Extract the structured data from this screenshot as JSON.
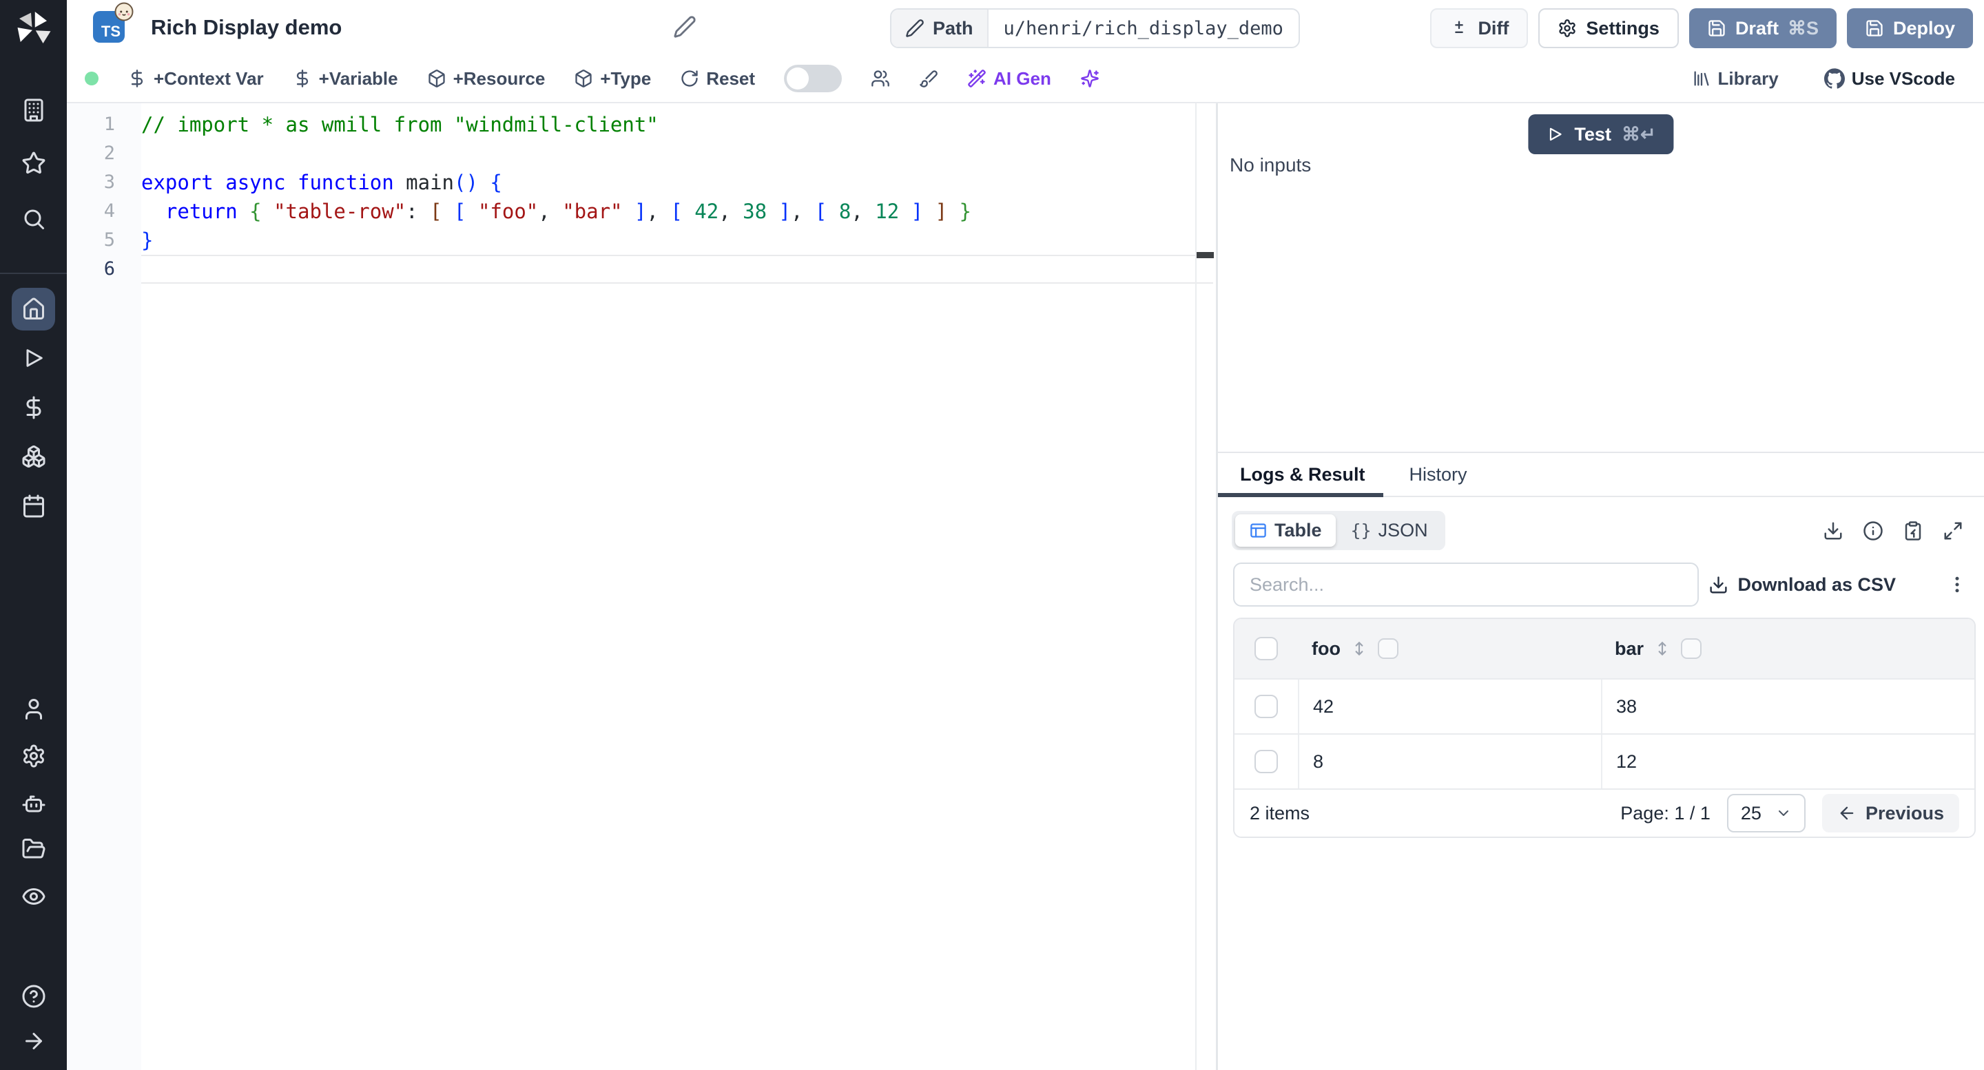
{
  "colors": {
    "slate-btn": "#6b82a6",
    "test-navy": "#3a4a64",
    "ai-purple": "#7c3aed",
    "ts-blue": "#3178c6",
    "table-blue": "#3b82f6",
    "status-green": "#7ee2a8",
    "sidebar-active": "#40506b"
  },
  "header": {
    "title": "Rich Display demo",
    "language_badge": "TS",
    "path_label": "Path",
    "path_value": "u/henri/rich_display_demo",
    "diff_label": "Diff",
    "settings_label": "Settings",
    "draft_label": "Draft",
    "draft_shortcut": "⌘S",
    "deploy_label": "Deploy"
  },
  "toolbar": {
    "context_var": "+Context Var",
    "variable": "+Variable",
    "resource": "+Resource",
    "type": "+Type",
    "reset": "Reset",
    "ai_gen": "AI Gen",
    "library": "Library",
    "vscode": "Use VScode"
  },
  "editor": {
    "active_line": 6,
    "lines": [
      {
        "num": "1",
        "tokens": [
          {
            "c": "comment",
            "t": "// import * as wmill from \"windmill-client\""
          }
        ]
      },
      {
        "num": "2",
        "tokens": []
      },
      {
        "num": "3",
        "tokens": [
          {
            "c": "kw",
            "t": "export"
          },
          {
            "c": "plain",
            "t": " "
          },
          {
            "c": "kw",
            "t": "async"
          },
          {
            "c": "plain",
            "t": " "
          },
          {
            "c": "kw",
            "t": "function"
          },
          {
            "c": "plain",
            "t": " "
          },
          {
            "c": "fn",
            "t": "main"
          },
          {
            "c": "b1",
            "t": "()"
          },
          {
            "c": "plain",
            "t": " "
          },
          {
            "c": "b1",
            "t": "{"
          }
        ]
      },
      {
        "num": "4",
        "tokens": [
          {
            "c": "plain",
            "t": "  "
          },
          {
            "c": "kw",
            "t": "return"
          },
          {
            "c": "plain",
            "t": " "
          },
          {
            "c": "b2",
            "t": "{"
          },
          {
            "c": "plain",
            "t": " "
          },
          {
            "c": "str",
            "t": "\"table-row\""
          },
          {
            "c": "plain",
            "t": ": "
          },
          {
            "c": "b3",
            "t": "["
          },
          {
            "c": "plain",
            "t": " "
          },
          {
            "c": "b1",
            "t": "["
          },
          {
            "c": "plain",
            "t": " "
          },
          {
            "c": "str",
            "t": "\"foo\""
          },
          {
            "c": "plain",
            "t": ", "
          },
          {
            "c": "str",
            "t": "\"bar\""
          },
          {
            "c": "plain",
            "t": " "
          },
          {
            "c": "b1",
            "t": "]"
          },
          {
            "c": "plain",
            "t": ", "
          },
          {
            "c": "b1",
            "t": "["
          },
          {
            "c": "plain",
            "t": " "
          },
          {
            "c": "num",
            "t": "42"
          },
          {
            "c": "plain",
            "t": ", "
          },
          {
            "c": "num",
            "t": "38"
          },
          {
            "c": "plain",
            "t": " "
          },
          {
            "c": "b1",
            "t": "]"
          },
          {
            "c": "plain",
            "t": ", "
          },
          {
            "c": "b1",
            "t": "["
          },
          {
            "c": "plain",
            "t": " "
          },
          {
            "c": "num",
            "t": "8"
          },
          {
            "c": "plain",
            "t": ", "
          },
          {
            "c": "num",
            "t": "12"
          },
          {
            "c": "plain",
            "t": " "
          },
          {
            "c": "b1",
            "t": "]"
          },
          {
            "c": "plain",
            "t": " "
          },
          {
            "c": "b3",
            "t": "]"
          },
          {
            "c": "plain",
            "t": " "
          },
          {
            "c": "b2",
            "t": "}"
          }
        ]
      },
      {
        "num": "5",
        "tokens": [
          {
            "c": "b1",
            "t": "}"
          }
        ]
      },
      {
        "num": "6",
        "tokens": []
      }
    ]
  },
  "run_panel": {
    "test_label": "Test",
    "test_shortcut": "⌘↵",
    "no_inputs": "No inputs"
  },
  "results": {
    "tabs": {
      "logs": "Logs & Result",
      "history": "History"
    },
    "view_modes": {
      "table": "Table",
      "json": "JSON",
      "braces_glyph": "{}"
    },
    "search_placeholder": "Search...",
    "download_csv_label": "Download as CSV",
    "table": {
      "columns": [
        "foo",
        "bar"
      ],
      "rows": [
        [
          "42",
          "38"
        ],
        [
          "8",
          "12"
        ]
      ],
      "items_count": "2 items",
      "page_label": "Page: 1 / 1",
      "page_size": "25",
      "previous_label": "Previous"
    }
  },
  "sidebar": {
    "icons": [
      "windmill-logo",
      "building",
      "star",
      "search",
      "home",
      "play",
      "dollar",
      "boxes",
      "calendar",
      "user",
      "settings",
      "bot",
      "folder-open",
      "eye",
      "help",
      "arrow-right"
    ],
    "active_item": "home"
  }
}
